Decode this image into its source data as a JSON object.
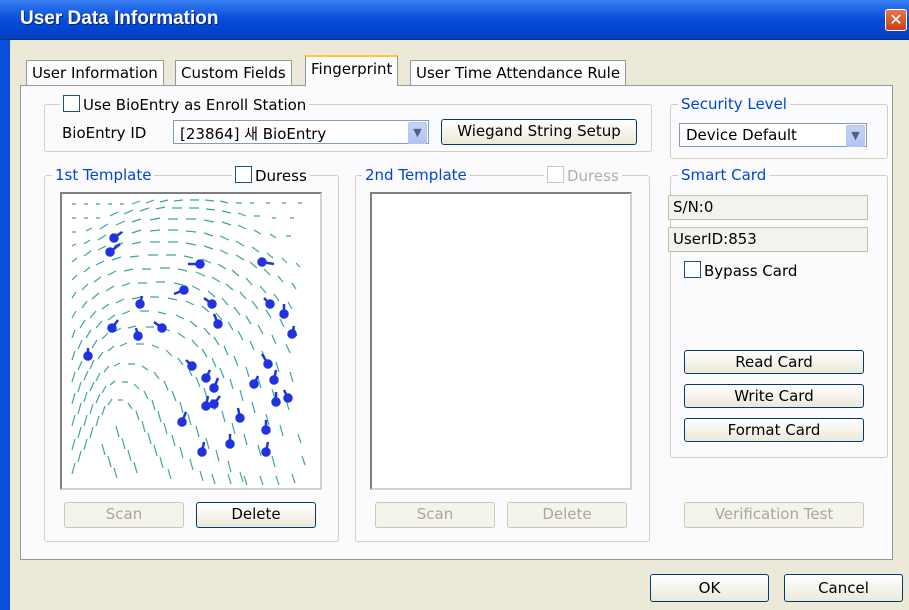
{
  "window": {
    "title": "User Data Information",
    "close_icon": "close-icon"
  },
  "tabs": [
    {
      "label": "User Information"
    },
    {
      "label": "Custom Fields"
    },
    {
      "label": "Fingerprint",
      "active": true
    },
    {
      "label": "User Time Attendance Rule"
    }
  ],
  "enroll": {
    "use_bioentry_label": "Use BioEntry as Enroll Station",
    "use_bioentry_checked": false,
    "bioentry_id_label": "BioEntry ID",
    "bioentry_id_value": "[23864] 새 BioEntry",
    "wiegand_button": "Wiegand String Setup"
  },
  "security": {
    "title": "Security Level",
    "value": "Device Default"
  },
  "template1": {
    "title": "1st Template",
    "duress_label": "Duress",
    "duress_checked": false,
    "scan_label": "Scan",
    "delete_label": "Delete"
  },
  "template2": {
    "title": "2nd Template",
    "duress_label": "Duress",
    "duress_checked": false,
    "scan_label": "Scan",
    "delete_label": "Delete"
  },
  "smart_card": {
    "title": "Smart Card",
    "serial": "S/N:0",
    "user_id": "UserID:853",
    "bypass_label": "Bypass Card",
    "bypass_checked": false,
    "read_button": "Read Card",
    "write_button": "Write Card",
    "format_button": "Format Card"
  },
  "verification_button": "Verification Test",
  "footer": {
    "ok_label": "OK",
    "cancel_label": "Cancel"
  }
}
